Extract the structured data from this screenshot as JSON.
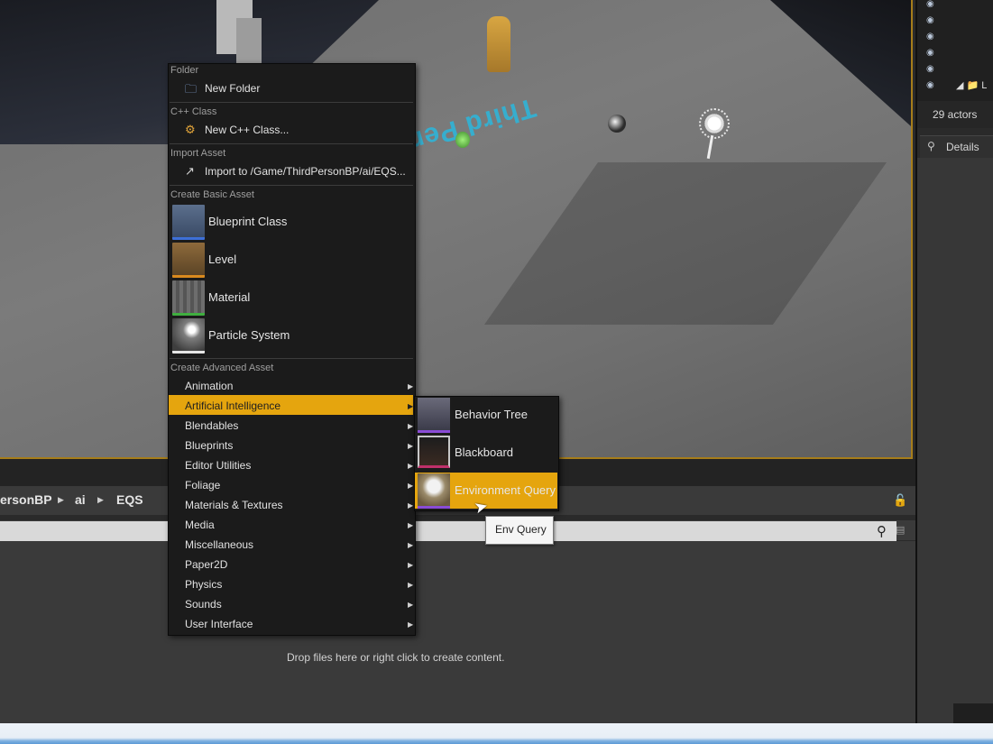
{
  "viewport": {
    "text3d": "Third Per"
  },
  "outliner": {
    "folder_label": "L",
    "actor_count": "29 actors"
  },
  "details": {
    "tab_label": "Details"
  },
  "content_browser": {
    "breadcrumb": [
      "ersonBP",
      "ai",
      "EQS"
    ],
    "search": {
      "value": ""
    },
    "drop_hint": "Drop files here or right click to create content."
  },
  "menu": {
    "folder_section": {
      "header": "Folder",
      "item": "New Folder"
    },
    "cpp_section": {
      "header": "C++ Class",
      "item": "New C++ Class..."
    },
    "import_section": {
      "header": "Import Asset",
      "item": "Import to /Game/ThirdPersonBP/ai/EQS..."
    },
    "basic_section": {
      "header": "Create Basic Asset",
      "items": [
        {
          "label": "Blueprint Class",
          "icon": "blueprint-class-icon",
          "color": "#3d6fd8"
        },
        {
          "label": "Level",
          "icon": "level-icon",
          "color": "#d98a1e"
        },
        {
          "label": "Material",
          "icon": "material-icon",
          "color": "#3fae3f"
        },
        {
          "label": "Particle System",
          "icon": "particle-system-icon",
          "color": "#e6e6e6"
        }
      ]
    },
    "advanced_section": {
      "header": "Create Advanced Asset",
      "items": [
        "Animation",
        "Artificial Intelligence",
        "Blendables",
        "Blueprints",
        "Editor Utilities",
        "Foliage",
        "Materials & Textures",
        "Media",
        "Miscellaneous",
        "Paper2D",
        "Physics",
        "Sounds",
        "User Interface"
      ],
      "selected": "Artificial Intelligence"
    }
  },
  "submenu": {
    "items": [
      {
        "label": "Behavior Tree",
        "icon": "behavior-tree-icon",
        "color": "#8a4cd6"
      },
      {
        "label": "Blackboard",
        "icon": "blackboard-icon",
        "color": "#c0306a"
      },
      {
        "label": "Environment Query",
        "icon": "environment-query-icon",
        "color": "#8a4cd6"
      }
    ],
    "hovered": "Environment Query"
  },
  "tooltip": {
    "text": "Env Query"
  },
  "colors": {
    "accent": "#e5a50e",
    "menu_bg": "#1b1b1b",
    "viewport_border": "#a67d1a"
  }
}
